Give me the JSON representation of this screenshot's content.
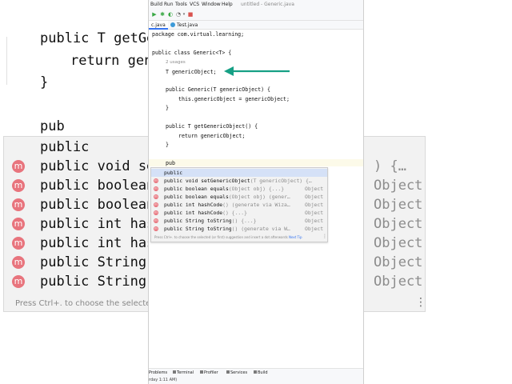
{
  "background_editor": {
    "line1": "public T getGen",
    "line2": "return gener",
    "line3": "}",
    "typed": "pub",
    "popup_rows": [
      {
        "text": "public",
        "type": ""
      },
      {
        "text": "public void set",
        "type": ") {…"
      },
      {
        "text": "public boolean ",
        "type": "Object"
      },
      {
        "text": "public boolean ",
        "type": "Object"
      },
      {
        "text": "public int has",
        "type": "Object"
      },
      {
        "text": "public int has",
        "type": "Object"
      },
      {
        "text": "public String t",
        "type": "Object"
      },
      {
        "text": "public String t",
        "type": "Object"
      }
    ],
    "hint": "Press Ctrl+. to choose the selected (o"
  },
  "menubar": {
    "items": [
      "Build",
      "Run",
      "Tools",
      "VCS",
      "Window",
      "Help"
    ],
    "title": "untitled - Generic.java"
  },
  "tabs": [
    {
      "label": "c.java",
      "active": true
    },
    {
      "label": "Test.java",
      "active": false
    }
  ],
  "code": {
    "package": "package com.virtual.learning;",
    "class_decl": "public class Generic<T> {",
    "usages": "2 usages",
    "field": "T genericObject;",
    "ctor_decl": "public Generic(T genericObject) {",
    "ctor_body": "this.genericObject = genericObject;",
    "ctor_close": "}",
    "getter_decl": "public T getGenericObject() {",
    "getter_body": "return genericObject;",
    "getter_close": "}",
    "typed": "pub"
  },
  "completion": {
    "rows": [
      {
        "main": "public",
        "gray": "",
        "type": ""
      },
      {
        "main": "public void setGenericObject",
        "gray": "(T genericObject) {…",
        "type": ""
      },
      {
        "main": "public boolean equals",
        "gray": "(Object obj) {...}",
        "type": "Object"
      },
      {
        "main": "public boolean equals",
        "gray": "(Object obj) (gener…",
        "type": "Object"
      },
      {
        "main": "public int hashCode",
        "gray": "() (generate via Wiza…",
        "type": "Object"
      },
      {
        "main": "public int hashCode",
        "gray": "() {...}",
        "type": "Object"
      },
      {
        "main": "public String toString",
        "gray": "() {...}",
        "type": "Object"
      },
      {
        "main": "public String toString",
        "gray": "() (generate via W…",
        "type": "Object"
      }
    ],
    "hint": "Press Ctrl+. to choose the selected (or first) suggestion and insert a dot afterwards",
    "hint_link": "Next Tip"
  },
  "bottom_tools": [
    "Problems",
    "Terminal",
    "Profiler",
    "Services",
    "Build"
  ],
  "status": "rday 1:11 AM)",
  "colors": {
    "accent": "#3574f0",
    "arrow": "#16a085",
    "keyword": "#0033b3",
    "field": "#871094",
    "method_badge": "#e8747d"
  },
  "icons": [
    "run-icon",
    "debug-icon",
    "coverage-icon",
    "profile-icon",
    "stop-icon",
    "method-icon",
    "kebab-menu-icon"
  ]
}
